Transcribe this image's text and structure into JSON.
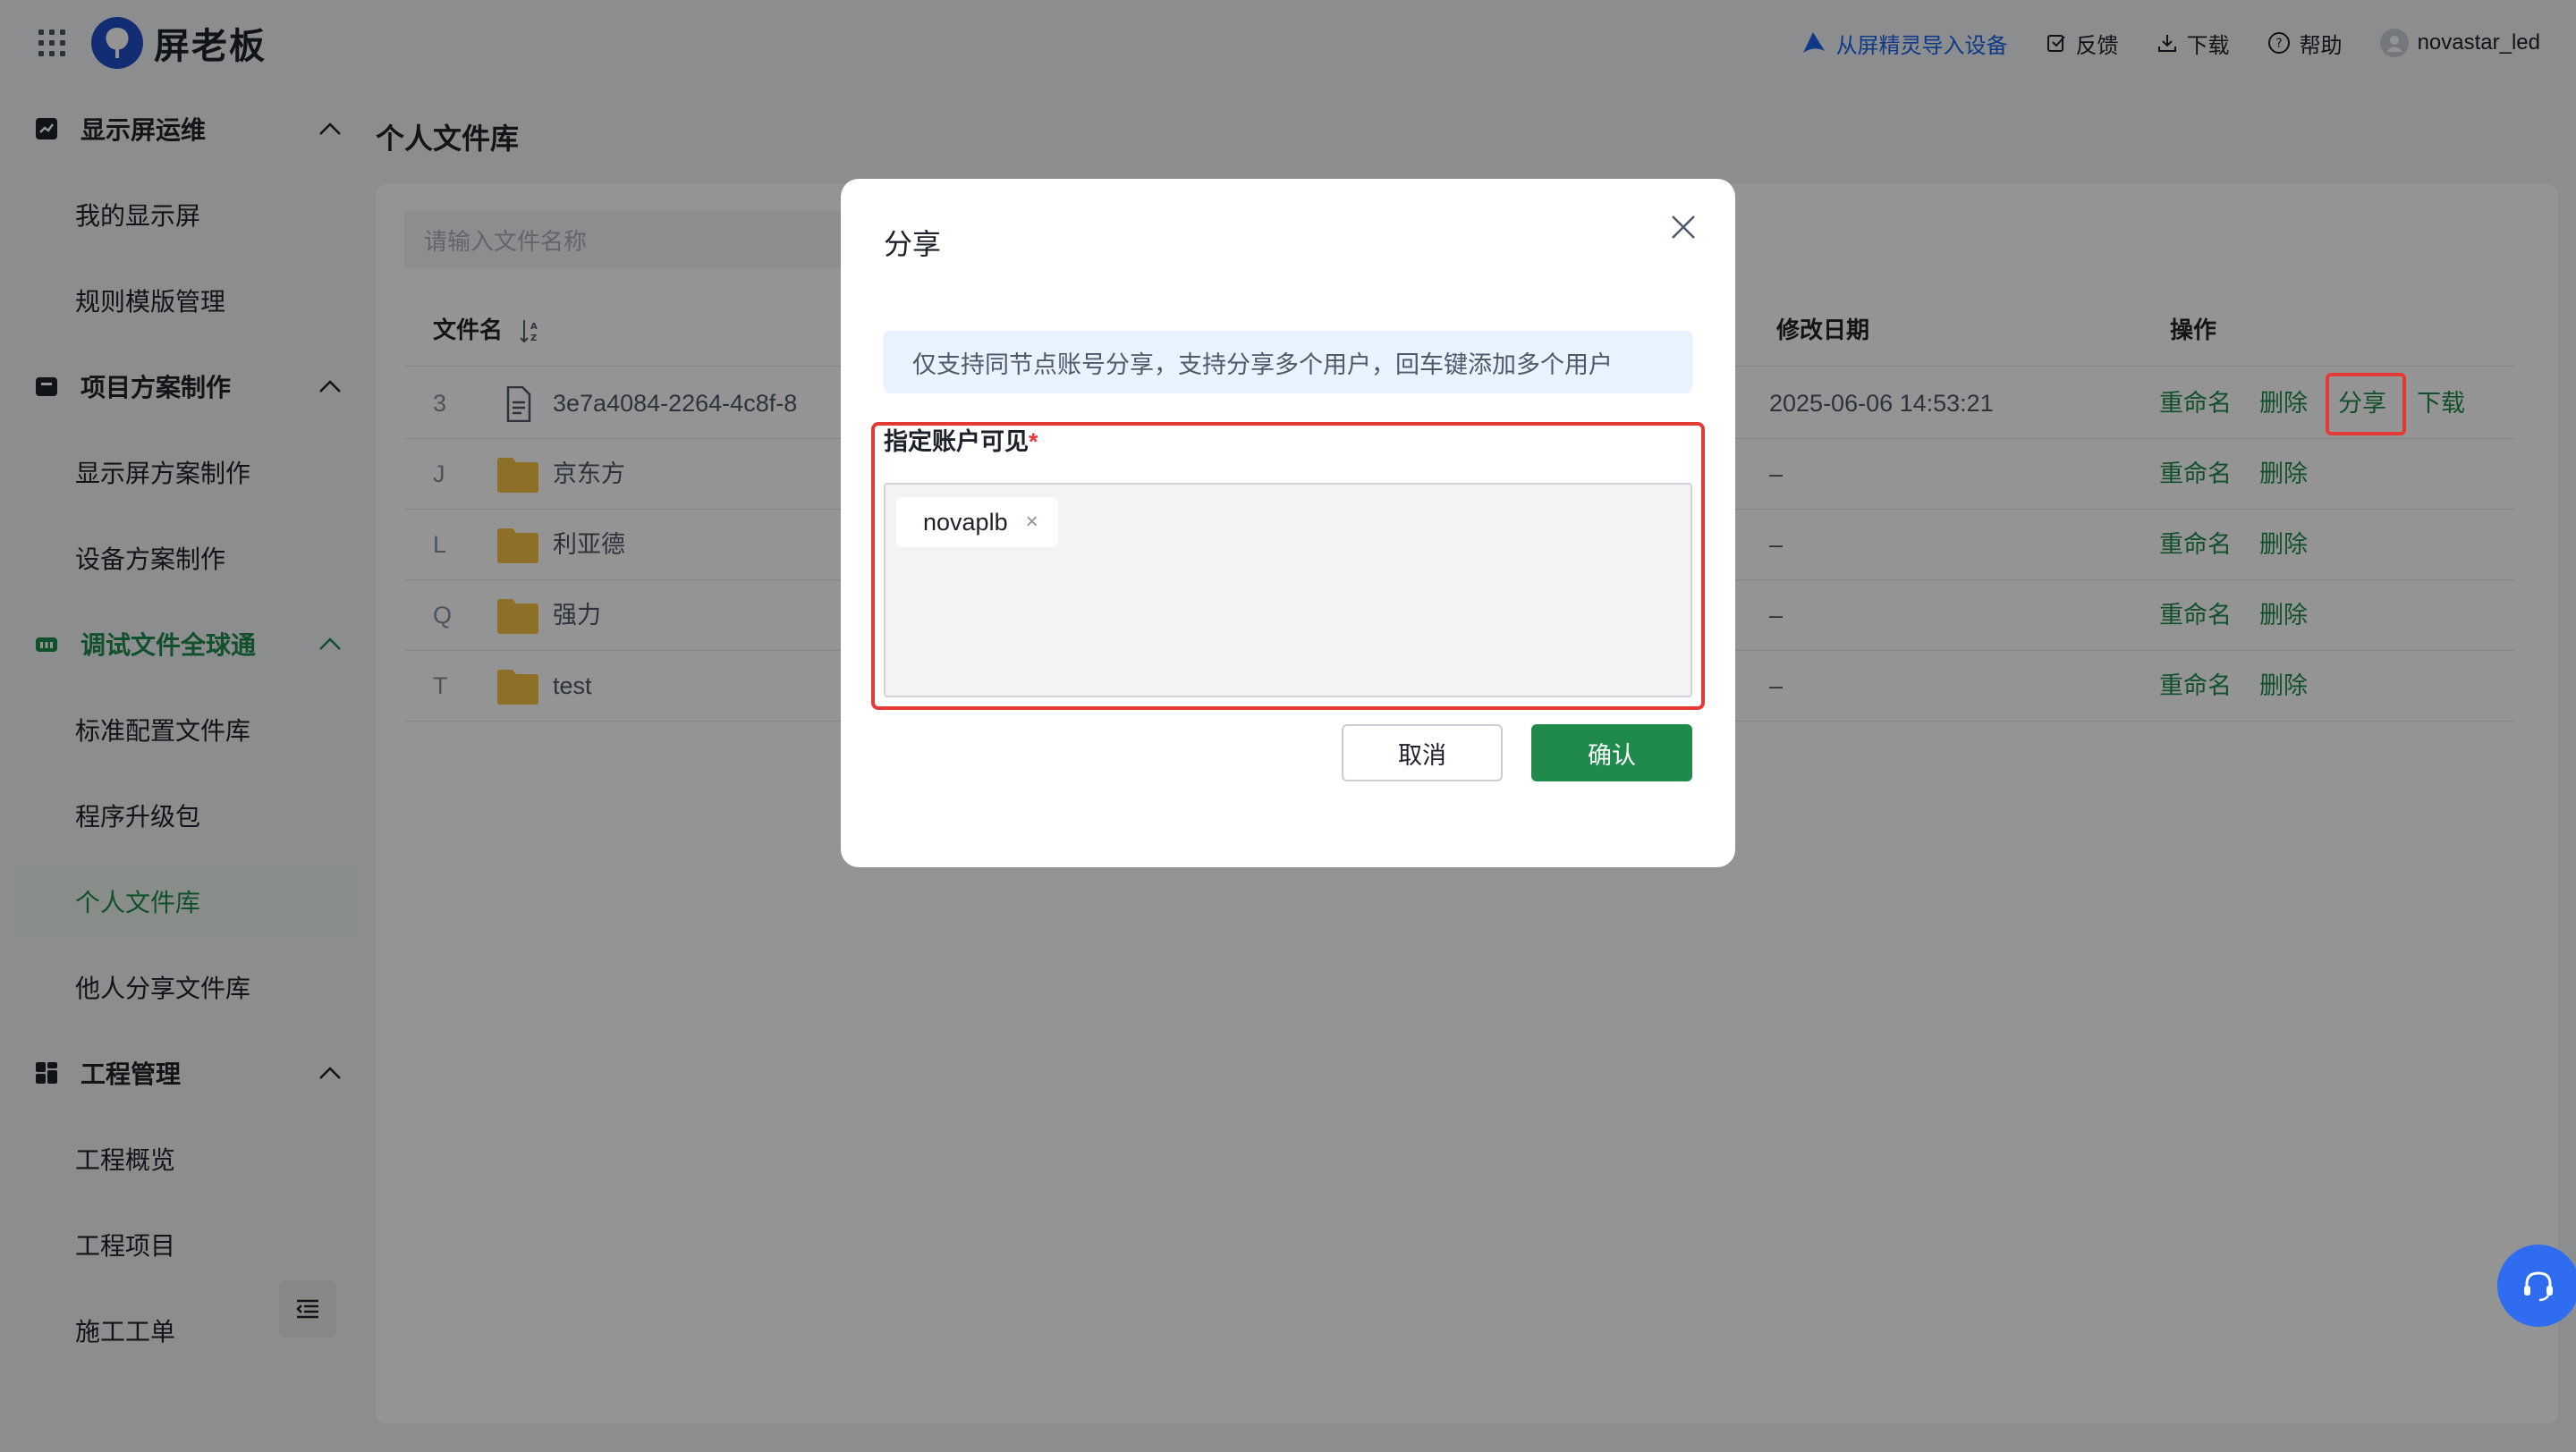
{
  "header": {
    "brand": "屏老板",
    "import_label": "从屏精灵导入设备",
    "feedback_label": "反馈",
    "download_label": "下载",
    "help_label": "帮助",
    "username": "novastar_led"
  },
  "sidebar": {
    "groups": [
      {
        "label": "显示屏运维",
        "items": [
          "我的显示屏",
          "规则模版管理"
        ]
      },
      {
        "label": "项目方案制作",
        "items": [
          "显示屏方案制作",
          "设备方案制作"
        ]
      },
      {
        "label": "调试文件全球通",
        "items": [
          "标准配置文件库",
          "程序升级包",
          "个人文件库",
          "他人分享文件库"
        ]
      },
      {
        "label": "工程管理",
        "items": [
          "工程概览",
          "工程项目",
          "施工工单"
        ]
      }
    ]
  },
  "main": {
    "title": "个人文件库",
    "search_placeholder": "请输入文件名称",
    "columns": {
      "name": "文件名",
      "date": "修改日期",
      "ops": "操作"
    },
    "rows": [
      {
        "idx": "3",
        "name": "3e7a4084-2264-4c8f-8",
        "date": "2025-06-06 14:53:21",
        "type": "file",
        "ops": [
          "重命名",
          "删除",
          "分享",
          "下载"
        ]
      },
      {
        "idx": "J",
        "name": "京东方",
        "date": "–",
        "type": "folder",
        "ops": [
          "重命名",
          "删除"
        ]
      },
      {
        "idx": "L",
        "name": "利亚德",
        "date": "–",
        "type": "folder",
        "ops": [
          "重命名",
          "删除"
        ]
      },
      {
        "idx": "Q",
        "name": "强力",
        "date": "–",
        "type": "folder",
        "ops": [
          "重命名",
          "删除"
        ]
      },
      {
        "idx": "T",
        "name": "test",
        "date": "–",
        "type": "folder",
        "ops": [
          "重命名",
          "删除"
        ]
      }
    ]
  },
  "modal": {
    "title": "分享",
    "alert": "仅支持同节点账号分享，支持分享多个用户，回车键添加多个用户",
    "field_label": "指定账户可见",
    "required_mark": "*",
    "tags": [
      "novaplb"
    ],
    "tag_remove": "×",
    "cancel_label": "取消",
    "confirm_label": "确认"
  },
  "colors": {
    "primary": "#1f8a4c",
    "link_blue": "#1a63e8",
    "highlight_red": "#e53935"
  }
}
